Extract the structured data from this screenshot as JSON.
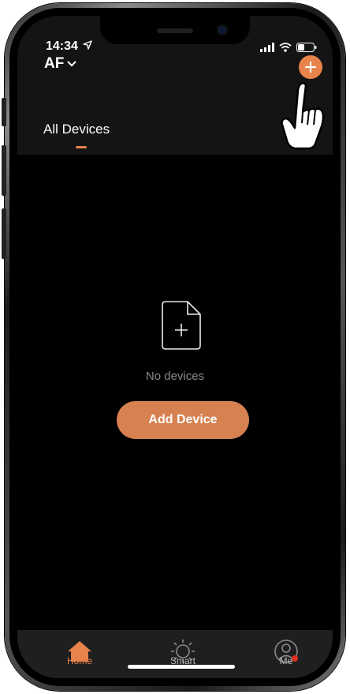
{
  "status": {
    "time": "14:34"
  },
  "header": {
    "home_name": "AF",
    "add_icon": "plus-icon"
  },
  "tabs": [
    {
      "label": "All Devices",
      "active": true
    }
  ],
  "empty_state": {
    "icon": "add-document-icon",
    "message": "No devices",
    "button_label": "Add Device"
  },
  "tabbar": {
    "items": [
      {
        "label": "Home",
        "icon": "home-icon",
        "active": true
      },
      {
        "label": "Smart",
        "icon": "sun-icon",
        "active": false
      },
      {
        "label": "Me",
        "icon": "user-icon",
        "active": false
      }
    ]
  },
  "colors": {
    "accent": "#e7834b",
    "background": "#000000",
    "header_bg": "#141414",
    "tabbar_bg": "#1f1f1f"
  }
}
